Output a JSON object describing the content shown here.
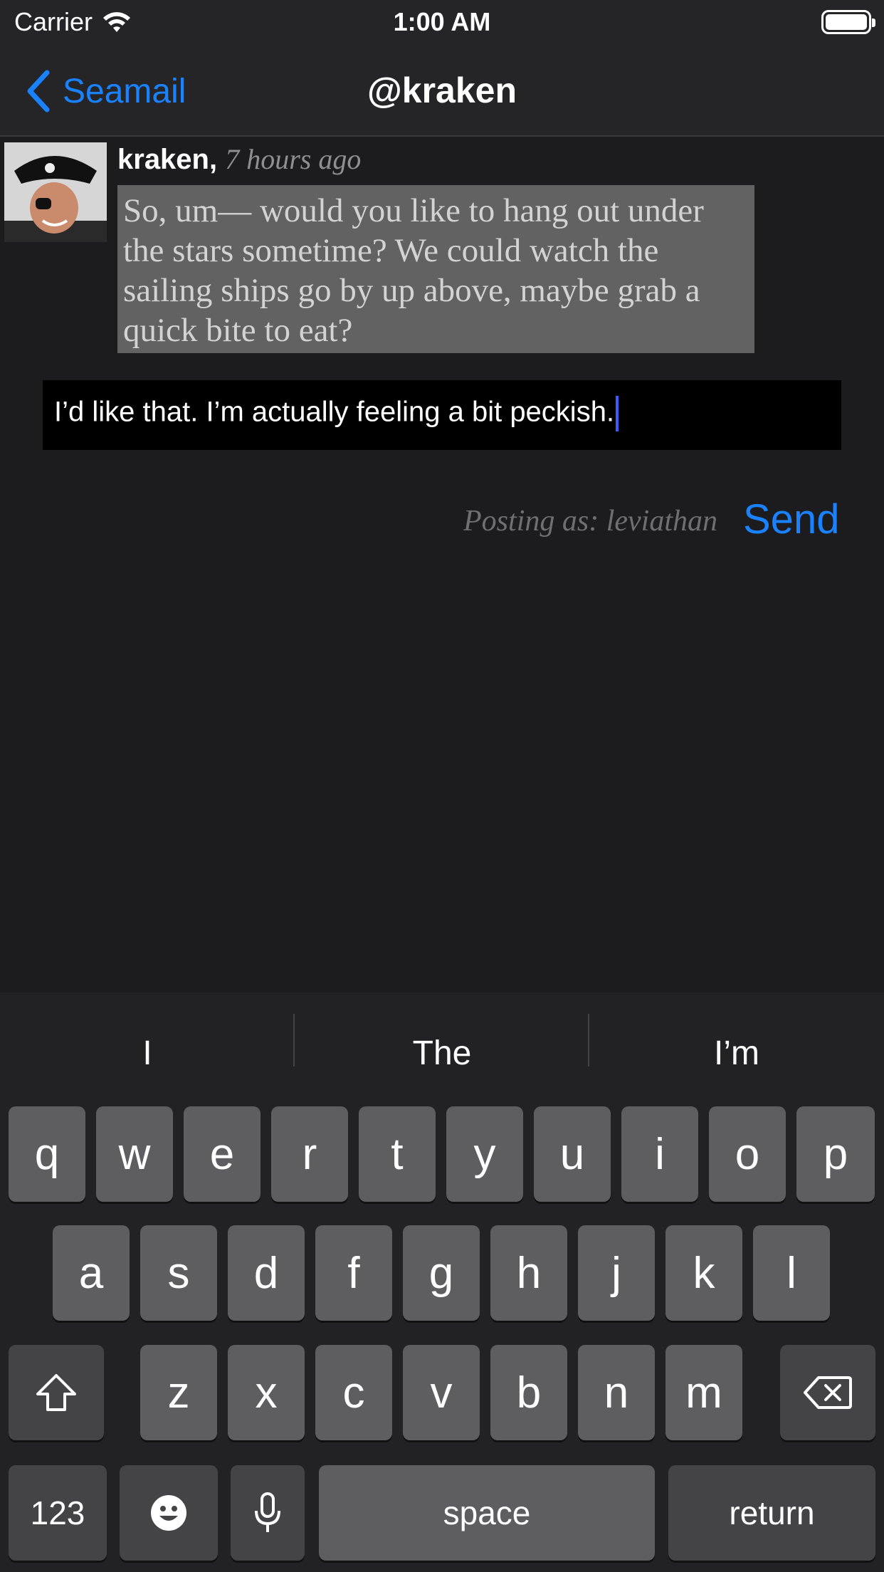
{
  "status_bar": {
    "carrier": "Carrier",
    "time": "1:00 AM"
  },
  "nav": {
    "back_label": "Seamail",
    "title": "@kraken"
  },
  "message": {
    "author": "kraken,",
    "time": "7 hours ago",
    "text": "So, um— would you like to hang out under the stars sometime? We could watch the sailing ships go by up above, maybe grab a quick bite to eat?"
  },
  "compose": {
    "value": "I’d like that. I’m actually feeling a bit peckish."
  },
  "posting_as": "Posting as: leviathan",
  "send_label": "Send",
  "keyboard": {
    "suggestions": [
      "I",
      "The",
      "I’m"
    ],
    "row1": [
      "q",
      "w",
      "e",
      "r",
      "t",
      "y",
      "u",
      "i",
      "o",
      "p"
    ],
    "row2": [
      "a",
      "s",
      "d",
      "f",
      "g",
      "h",
      "j",
      "k",
      "l"
    ],
    "row3": [
      "z",
      "x",
      "c",
      "v",
      "b",
      "n",
      "m"
    ],
    "numbers_label": "123",
    "space_label": "space",
    "return_label": "return"
  }
}
